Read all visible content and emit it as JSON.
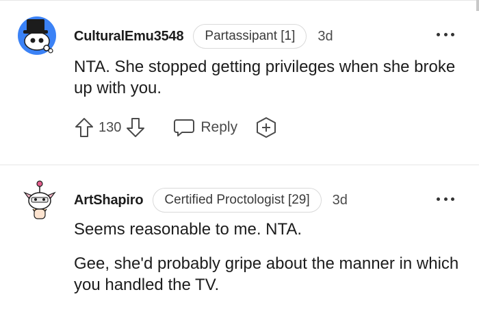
{
  "comments": [
    {
      "username": "CulturalEmu3548",
      "flair": "Partassipant [1]",
      "age": "3d",
      "body": [
        "NTA. She stopped getting privileges when she broke up with you."
      ],
      "score": "130",
      "reply_label": "Reply",
      "avatar_icon": "snoo-avatar-top-hat-icon"
    },
    {
      "username": "ArtShapiro",
      "flair": "Certified Proctologist [29]",
      "age": "3d",
      "body": [
        "Seems reasonable to me. NTA.",
        "Gee, she'd probably gripe about the manner in which you handled the TV."
      ],
      "avatar_icon": "snoo-avatar-antenna-icon"
    }
  ],
  "colors": {
    "text": "#1c1c1c",
    "muted": "#4a4a4a",
    "divider": "#e6e6e6",
    "avatar_bg": "#3b82f6"
  }
}
